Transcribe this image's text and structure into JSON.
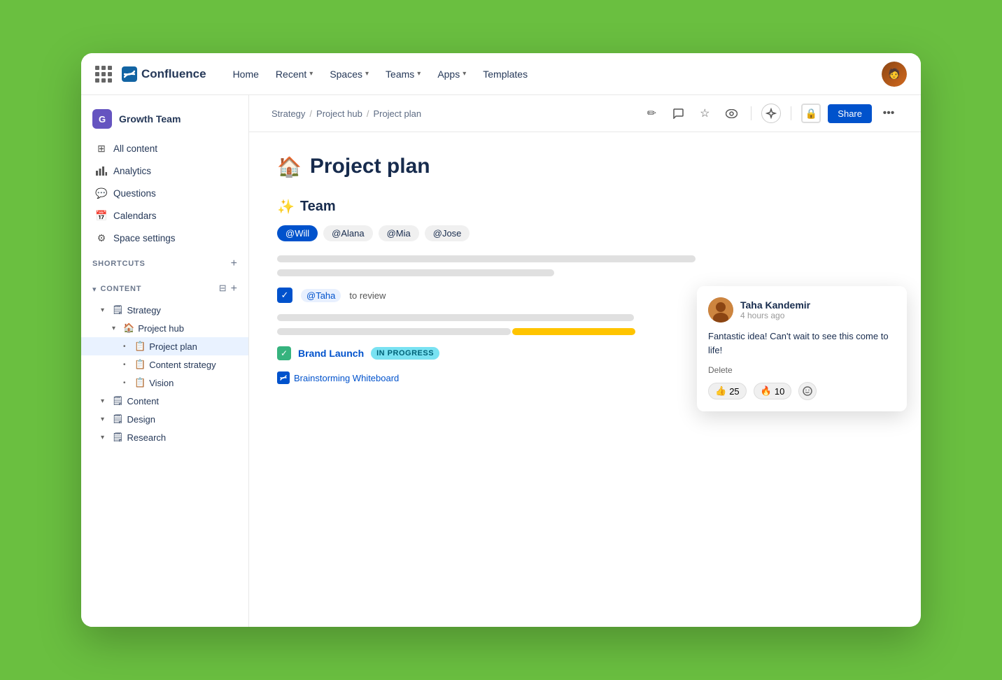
{
  "app": {
    "name": "Confluence",
    "logo_letter": "✕"
  },
  "nav": {
    "links": [
      {
        "label": "Home",
        "has_dropdown": false
      },
      {
        "label": "Recent",
        "has_dropdown": true
      },
      {
        "label": "Spaces",
        "has_dropdown": true
      },
      {
        "label": "Teams",
        "has_dropdown": true
      },
      {
        "label": "Apps",
        "has_dropdown": true
      },
      {
        "label": "Templates",
        "has_dropdown": false
      }
    ]
  },
  "sidebar": {
    "space_name": "Growth Team",
    "space_initial": "G",
    "items": [
      {
        "label": "All content",
        "icon": "⊞"
      },
      {
        "label": "Analytics",
        "icon": "📊"
      },
      {
        "label": "Questions",
        "icon": "💬"
      },
      {
        "label": "Calendars",
        "icon": "📅"
      },
      {
        "label": "Space settings",
        "icon": "⚙"
      }
    ],
    "shortcuts_label": "SHORTCUTS",
    "content_label": "CONTENT",
    "tree": [
      {
        "label": "Strategy",
        "indent": 0,
        "icon": "🗒",
        "caret": "▾"
      },
      {
        "label": "Project hub",
        "indent": 1,
        "icon": "🏠",
        "caret": "▾"
      },
      {
        "label": "Project plan",
        "indent": 2,
        "icon": "📋",
        "caret": "•",
        "active": true
      },
      {
        "label": "Content strategy",
        "indent": 2,
        "icon": "📋",
        "caret": "•"
      },
      {
        "label": "Vision",
        "indent": 2,
        "icon": "📋",
        "caret": "•"
      },
      {
        "label": "Content",
        "indent": 0,
        "icon": "🗒",
        "caret": "▾"
      },
      {
        "label": "Design",
        "indent": 0,
        "icon": "🗒",
        "caret": "▾"
      },
      {
        "label": "Research",
        "indent": 0,
        "icon": "🗒",
        "caret": "▾"
      }
    ]
  },
  "breadcrumb": {
    "items": [
      "Strategy",
      "Project hub",
      "Project plan"
    ]
  },
  "page": {
    "title": "Project plan",
    "title_emoji": "🏠",
    "team_section_icon": "✨",
    "team_section_label": "Team",
    "team_tags": [
      {
        "label": "@Will",
        "style": "primary"
      },
      {
        "label": "@Alana",
        "style": "secondary"
      },
      {
        "label": "@Mia",
        "style": "secondary"
      },
      {
        "label": "@Jose",
        "style": "secondary"
      }
    ],
    "lines": [
      {
        "width": "68%"
      },
      {
        "width": "45%"
      }
    ],
    "task": {
      "mention": "@Taha",
      "text": "to review"
    },
    "task_lines": [
      {
        "width": "60%"
      },
      {
        "width": "40%",
        "highlighted": true
      }
    ],
    "brand_launch": {
      "label": "Brand Launch",
      "status": "IN PROGRESS"
    },
    "whiteboard_link": "Brainstorming Whiteboard"
  },
  "comment": {
    "user_name": "Taha Kandemir",
    "time_ago": "4 hours ago",
    "body": "Fantastic idea! Can't wait to see this come to life!",
    "delete_label": "Delete",
    "reactions": [
      {
        "emoji": "👍",
        "count": "25"
      },
      {
        "emoji": "🔥",
        "count": "10"
      }
    ]
  },
  "actions": {
    "edit_icon": "✏",
    "comment_icon": "💬",
    "star_icon": "☆",
    "watch_icon": "👁",
    "ai_icon": "✳",
    "lock_icon": "🔒",
    "share_label": "Share",
    "more_icon": "⋯"
  }
}
